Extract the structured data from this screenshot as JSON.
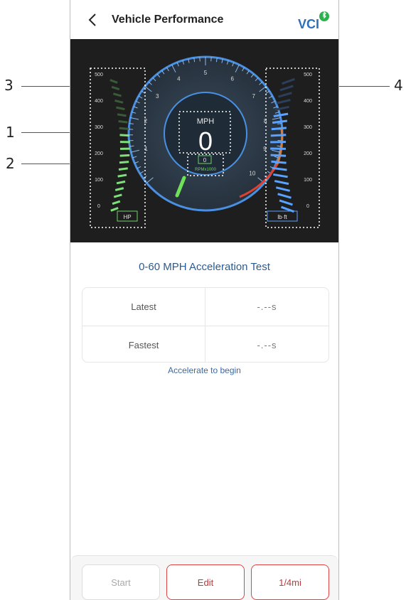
{
  "header": {
    "title": "Vehicle Performance",
    "logo_text": "VCI"
  },
  "callouts": [
    "1",
    "2",
    "3",
    "4"
  ],
  "gauge": {
    "speed_unit": "MPH",
    "speed_value": "0",
    "rpm_value": "0",
    "rpm_unit": "RPMx1000",
    "rpm_ticks": [
      "1",
      "2",
      "3",
      "4",
      "5",
      "6",
      "7",
      "8",
      "9",
      "10"
    ],
    "hp_scale": [
      "500",
      "400",
      "300",
      "200",
      "100",
      "0"
    ],
    "hp_unit": "HP",
    "hp_level": 0.62,
    "torque_scale": [
      "500",
      "400",
      "300",
      "200",
      "100",
      "0"
    ],
    "torque_unit": "lb·ft",
    "torque_level": 0.78,
    "colors": {
      "hp": "#7ee07a",
      "torque": "#5aa2ff",
      "redline": "#e04030",
      "ring": "#4a90e2"
    }
  },
  "test": {
    "title": "0-60 MPH Acceleration Test",
    "rows": [
      {
        "label": "Latest",
        "value": "-.--s"
      },
      {
        "label": "Fastest",
        "value": "-.--s"
      }
    ],
    "hint": "Accelerate to begin"
  },
  "footer": {
    "start_label": "Start",
    "edit_label": "Edit",
    "quarter_label": "1/4mi"
  }
}
